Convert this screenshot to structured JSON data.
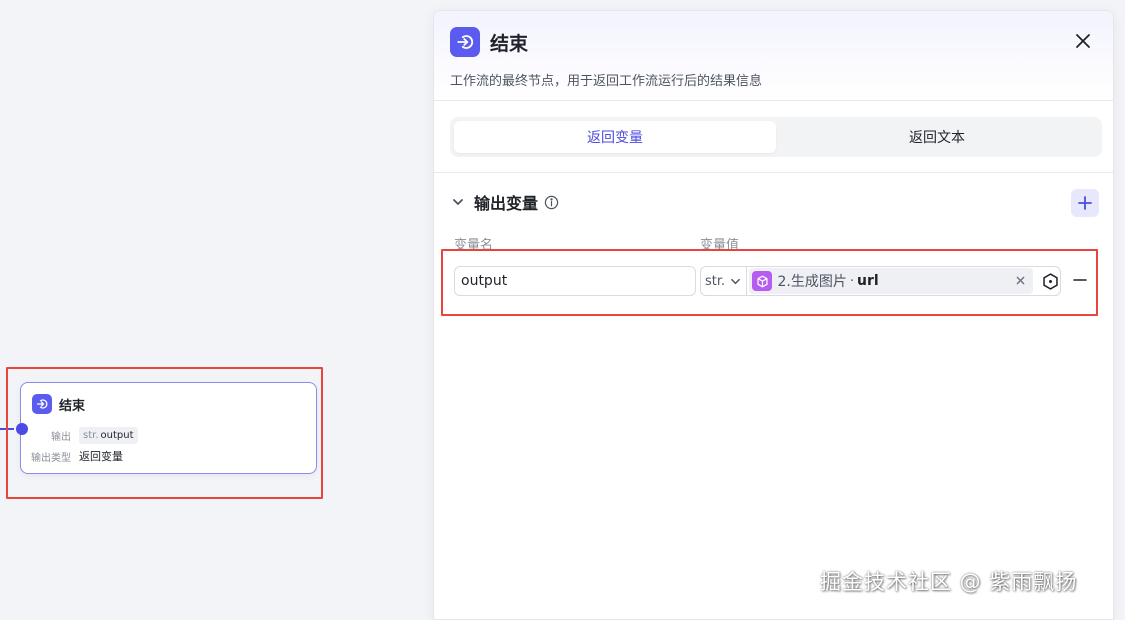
{
  "node": {
    "title": "结束",
    "output_label": "输出",
    "output_type_prefix": "str.",
    "output_name": "output",
    "type_label": "输出类型",
    "type_value": "返回变量"
  },
  "panel": {
    "title": "结束",
    "description": "工作流的最终节点，用于返回工作流运行后的结果信息",
    "tabs": [
      {
        "label": "返回变量",
        "active": true
      },
      {
        "label": "返回文本",
        "active": false
      }
    ],
    "section": {
      "title": "输出变量",
      "columns": {
        "name": "变量名",
        "value": "变量值"
      }
    },
    "variable": {
      "name": "output",
      "type": "str.",
      "ref_node": "2.生成图片",
      "ref_separator": "·",
      "ref_field": "url"
    }
  },
  "watermark": "掘金技术社区 @ 紫雨飘扬",
  "colors": {
    "accent": "#5b5bf0",
    "highlight": "#e8453c",
    "ref_icon": "#b65cf0"
  },
  "icons": {
    "node": "exit-icon",
    "close": "close-icon",
    "collapse": "chevron-down-icon",
    "info": "info-icon",
    "add": "plus-icon",
    "remove": "minus-icon",
    "ref": "cube-icon",
    "picker": "variable-picker-icon"
  }
}
